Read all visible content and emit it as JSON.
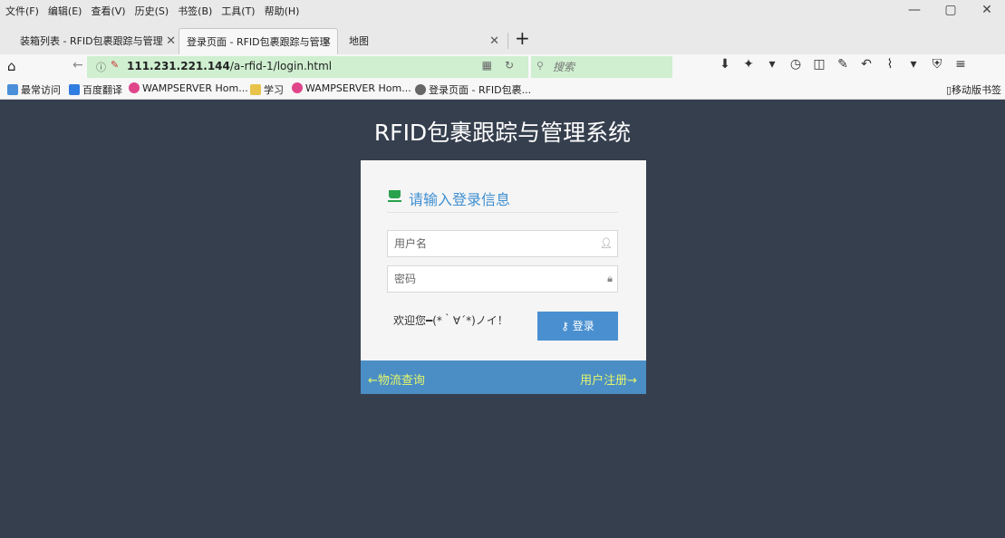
{
  "menubar": {
    "items": [
      "文件(F)",
      "编辑(E)",
      "查看(V)",
      "历史(S)",
      "书签(B)",
      "工具(T)",
      "帮助(H)"
    ],
    "minimize": "—",
    "restore": "▢",
    "close": "✕"
  },
  "tabs": [
    {
      "label": "装箱列表 - RFID包裹跟踪与管理"
    },
    {
      "label": "登录页面 - RFID包裹跟踪与管理"
    },
    {
      "label": "地图"
    }
  ],
  "navbar": {
    "url_host": "111.231.221.144",
    "url_path": "/a-rfid-1/login.html",
    "search_placeholder": "搜索"
  },
  "bookmarks": {
    "items": [
      {
        "label": "最常访问",
        "color": "#4a8fd8"
      },
      {
        "label": "百度翻译",
        "color": "#2f7de1"
      },
      {
        "label": "WAMPSERVER Hom...",
        "color": "#e0458a"
      },
      {
        "label": "学习",
        "color": "#e8c34a"
      },
      {
        "label": "WAMPSERVER Hom...",
        "color": "#e0458a"
      },
      {
        "label": "登录页面 - RFID包裹...",
        "color": "#666666"
      }
    ],
    "mobile": "移动版书签"
  },
  "page": {
    "title": "RFID包裹跟踪与管理系统",
    "heading": "请输入登录信息",
    "username_placeholder": "用户名",
    "password_placeholder": "密码",
    "welcome": "欢迎您━(*｀∀´*)ノイ！",
    "login_button": "登录",
    "footer_left": "物流查询",
    "footer_right": "用户注册"
  },
  "colors": {
    "background": "#363f4e",
    "accent": "#4a90d0",
    "footer_text": "#e4f56c",
    "heading_text": "#3f8fd1"
  }
}
